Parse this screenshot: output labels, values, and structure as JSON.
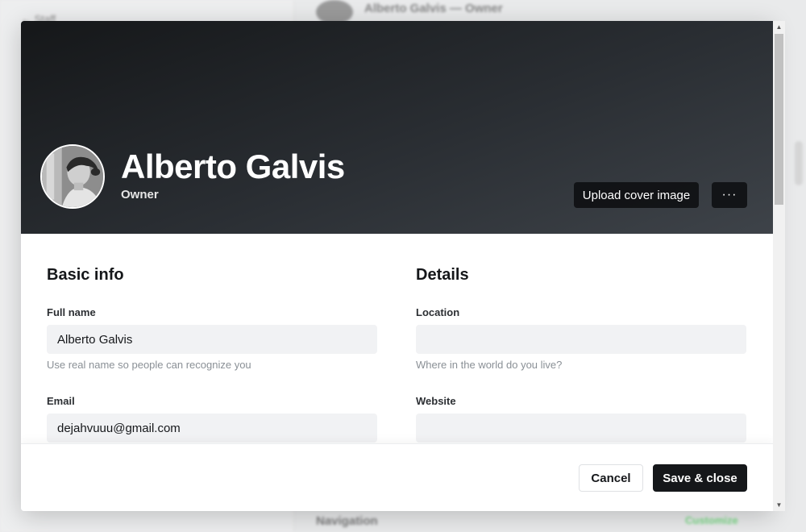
{
  "background": {
    "back_label": "← Staff",
    "header_text": "Alberto Galvis — Owner",
    "nav_title": "Navigation",
    "nav_action": "Customize"
  },
  "profile": {
    "name": "Alberto Galvis",
    "role": "Owner",
    "upload_cover_label": "Upload cover image",
    "more_label": "···"
  },
  "basic_info": {
    "title": "Basic info",
    "full_name": {
      "label": "Full name",
      "value": "Alberto Galvis",
      "hint": "Use real name so people can recognize you"
    },
    "email": {
      "label": "Email",
      "value": "dejahvuuu@gmail.com"
    }
  },
  "details": {
    "title": "Details",
    "location": {
      "label": "Location",
      "value": "",
      "hint": "Where in the world do you live?"
    },
    "website": {
      "label": "Website",
      "value": ""
    }
  },
  "footer": {
    "cancel_label": "Cancel",
    "save_label": "Save & close"
  },
  "colors": {
    "cover_dark": "#15171a",
    "primary_button": "#15171a",
    "input_bg": "#f1f2f4",
    "accent_green": "#30cf43"
  },
  "icons": {
    "more": "more-horizontal-icon",
    "scroll_up": "chevron-up-icon",
    "scroll_down": "chevron-down-icon"
  }
}
